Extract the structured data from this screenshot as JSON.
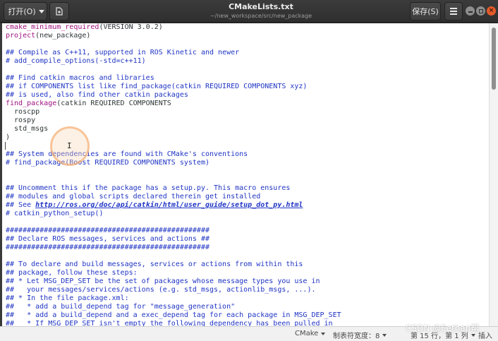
{
  "window": {
    "title": "CMakeLists.txt",
    "subtitle": "~/new_workspace/src/new_package"
  },
  "toolbar": {
    "open_label": "打开(O)",
    "save_label": "保存(S)"
  },
  "icons": {
    "new_document": "new-document-icon",
    "menu": "hamburger-menu-icon",
    "minimize": "minimize-icon",
    "maximize": "maximize-icon",
    "close": "close-icon"
  },
  "colors": {
    "comment": "#1f34c4",
    "function": "#a0127f",
    "close_button": "#e45a2a"
  },
  "code": {
    "lines": [
      [
        {
          "t": "cmake_minimum_required",
          "c": "fn"
        },
        {
          "t": "(VERSION 3.0.2)",
          "c": "txt"
        }
      ],
      [
        {
          "t": "project",
          "c": "fn"
        },
        {
          "t": "(new_package)",
          "c": "txt"
        }
      ],
      [],
      [
        {
          "t": "## Compile as C++11, supported in ROS Kinetic and newer",
          "c": "cmt"
        }
      ],
      [
        {
          "t": "# add_compile_options(-std=c++11)",
          "c": "cmt"
        }
      ],
      [],
      [
        {
          "t": "## Find catkin macros and libraries",
          "c": "cmt"
        }
      ],
      [
        {
          "t": "## if COMPONENTS list like find_package(catkin REQUIRED COMPONENTS xyz)",
          "c": "cmt"
        }
      ],
      [
        {
          "t": "## is used, also find other catkin packages",
          "c": "cmt"
        }
      ],
      [
        {
          "t": "find_package",
          "c": "fn"
        },
        {
          "t": "(catkin REQUIRED COMPONENTS",
          "c": "txt"
        }
      ],
      [
        {
          "t": "  roscpp",
          "c": "txt"
        }
      ],
      [
        {
          "t": "  rospy",
          "c": "txt"
        }
      ],
      [
        {
          "t": "  std_msgs",
          "c": "txt"
        }
      ],
      [
        {
          "t": ")",
          "c": "txt"
        }
      ],
      [],
      [
        {
          "t": "## System dependencies are found with CMake's conventions",
          "c": "cmt"
        }
      ],
      [
        {
          "t": "# find_package(Boost REQUIRED COMPONENTS system)",
          "c": "cmt"
        }
      ],
      [],
      [],
      [
        {
          "t": "## Uncomment this if the package has a setup.py. This macro ensures",
          "c": "cmt"
        }
      ],
      [
        {
          "t": "## modules and global scripts declared therein get installed",
          "c": "cmt"
        }
      ],
      [
        {
          "t": "## See ",
          "c": "cmt"
        },
        {
          "t": "http://ros.org/doc/api/catkin/html/user_guide/setup_dot_py.html",
          "c": "link"
        }
      ],
      [
        {
          "t": "# catkin_python_setup()",
          "c": "cmt"
        }
      ],
      [],
      [
        {
          "t": "################################################",
          "c": "cmt"
        }
      ],
      [
        {
          "t": "## Declare ROS messages, services and actions ##",
          "c": "cmt"
        }
      ],
      [
        {
          "t": "################################################",
          "c": "cmt"
        }
      ],
      [],
      [
        {
          "t": "## To declare and build messages, services or actions from within this",
          "c": "cmt"
        }
      ],
      [
        {
          "t": "## package, follow these steps:",
          "c": "cmt"
        }
      ],
      [
        {
          "t": "## * Let MSG_DEP_SET be the set of packages whose message types you use in",
          "c": "cmt"
        }
      ],
      [
        {
          "t": "##   your messages/services/actions (e.g. std_msgs, actionlib_msgs, ...).",
          "c": "cmt"
        }
      ],
      [
        {
          "t": "## * In the file package.xml:",
          "c": "cmt"
        }
      ],
      [
        {
          "t": "##   * add a build_depend tag for \"message_generation\"",
          "c": "cmt"
        }
      ],
      [
        {
          "t": "##   * add a build_depend and a exec_depend tag for each package in MSG_DEP_SET",
          "c": "cmt"
        }
      ],
      [
        {
          "t": "##   * If MSG_DEP_SET isn't empty the following dependency has been pulled in",
          "c": "cmt"
        }
      ]
    ]
  },
  "statusbar": {
    "language": "CMake",
    "tab_width": "制表符宽度：8",
    "position": "第 15 行，第 1 列",
    "mode": "插入"
  },
  "watermark": "CSDN @Eethan帮"
}
